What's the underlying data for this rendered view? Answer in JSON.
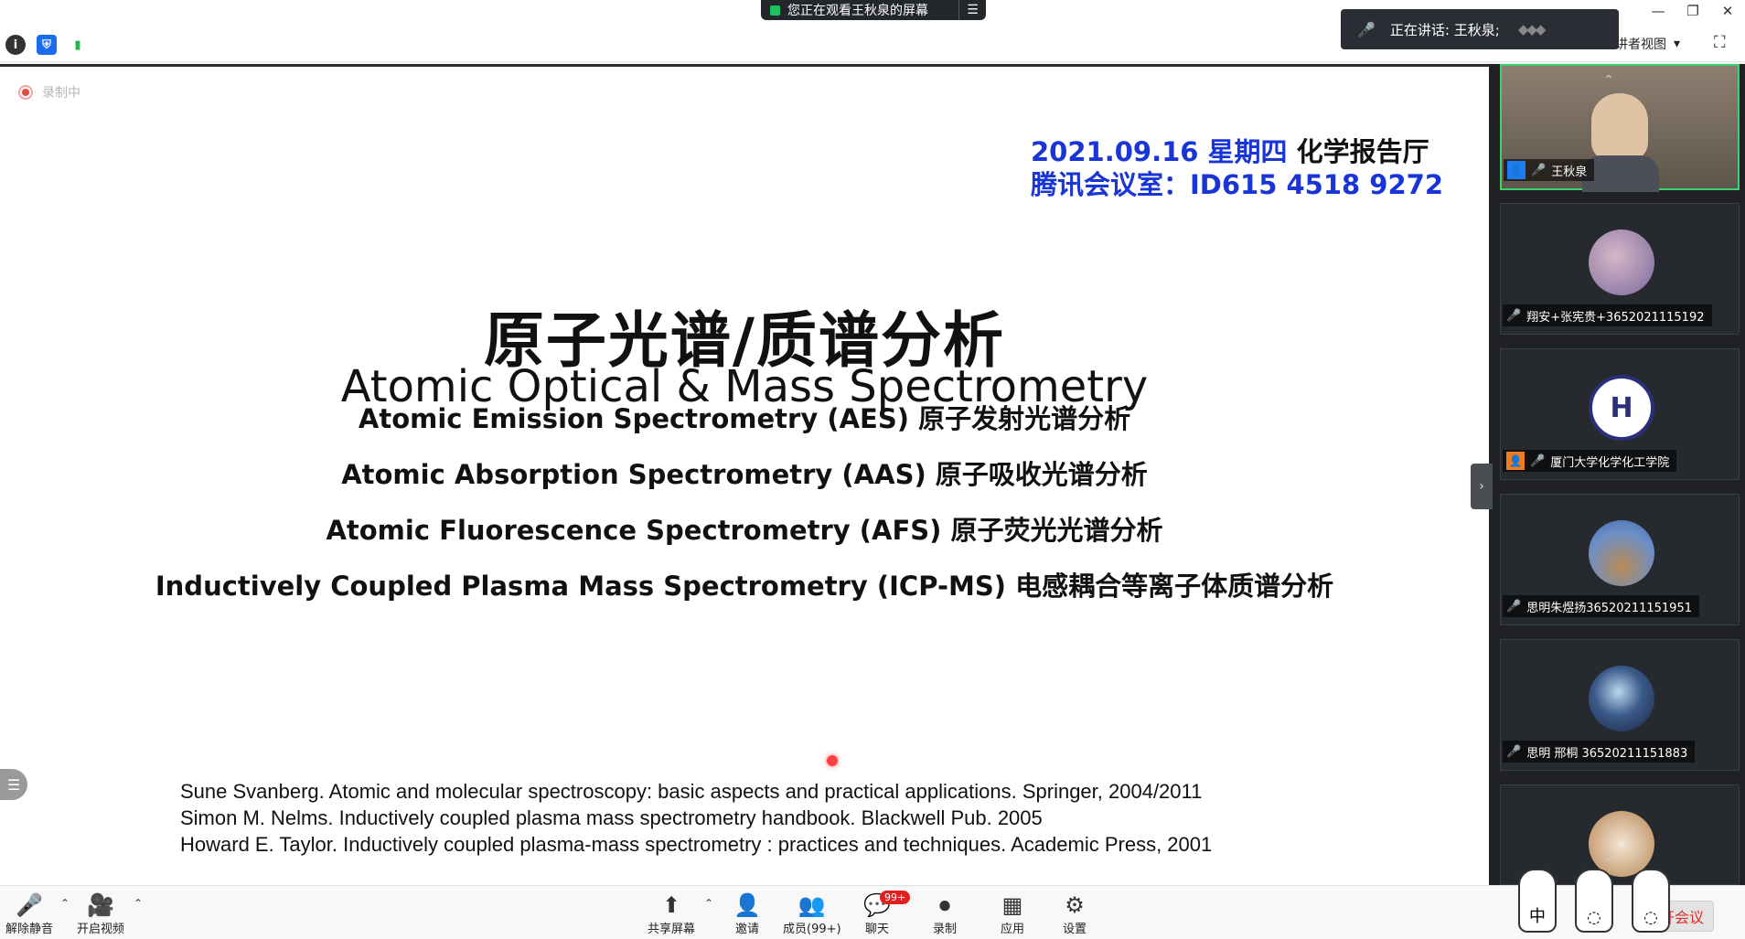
{
  "titlebar": {
    "share_banner": "您正在观看王秋泉的屏幕",
    "share_menu": "☰",
    "minimize": "—",
    "restore": "❐",
    "close": "✕"
  },
  "toolbar2": {
    "info_icon": "i",
    "shield_icon": "⛨",
    "signal_icon": "▮",
    "speaker_toast": "正在讲话: 王秋泉;",
    "view_switch": "讲者视图",
    "view_caret": "▾",
    "fullscreen": "⛶"
  },
  "slide": {
    "recording": "录制中",
    "date_line": "2021.09.16 星期四",
    "date_place": "化学报告厅",
    "meeting_line": "腾讯会议室：ID615 4518 9272",
    "title_cn": "原子光谱/质谱分析",
    "title_en": "Atomic Optical & Mass Spectrometry",
    "lines": [
      "Atomic Emission Spectrometry (AES) 原子发射光谱分析",
      "Atomic Absorption Spectrometry (AAS) 原子吸收光谱分析",
      "Atomic Fluorescence Spectrometry (AFS) 原子荧光光谱分析",
      "Inductively Coupled Plasma Mass Spectrometry (ICP-MS) 电感耦合等离子体质谱分析"
    ],
    "refs": [
      "Sune Svanberg. Atomic and molecular spectroscopy: basic aspects and practical applications. Springer, 2004/2011",
      "Simon M. Nelms. Inductively coupled plasma mass spectrometry handbook. Blackwell Pub. 2005",
      "Howard E. Taylor. Inductively coupled plasma-mass spectrometry : practices and techniques. Academic Press, 2001"
    ],
    "side_handle": "☰"
  },
  "participants": [
    {
      "name": "王秋泉",
      "mic": "on",
      "video": true
    },
    {
      "name": "翔安+张宪贵+3652021115192",
      "mic": "off",
      "avatar_color": "#9a8ab8"
    },
    {
      "name": "厦门大学化学化工学院",
      "mic": "off",
      "avatar_color": "#ffffff"
    },
    {
      "name": "思明朱煜扬36520211151951",
      "mic": "off",
      "avatar_color": "#6d8fc4"
    },
    {
      "name": "思明 邢桐 36520211151883",
      "mic": "off",
      "avatar_color": "#1b2540"
    },
    {
      "name": "",
      "mic": "off",
      "avatar_color": "#c9a27a"
    }
  ],
  "bottombar": {
    "unmute": "解除静音",
    "start_video": "开启视频",
    "share_screen": "共享屏幕",
    "invite": "邀请",
    "members": "成员(99+)",
    "chat": "聊天",
    "chat_badge": "99+",
    "record": "录制",
    "apps": "应用",
    "settings": "设置",
    "leave": "离开会议",
    "stickers": [
      "中",
      "◌",
      "◌"
    ]
  },
  "colors": {
    "accent_blue": "#1a35d6",
    "mic_off": "#e05252",
    "mic_on": "#3ad36c",
    "leave": "#e02e2e"
  }
}
